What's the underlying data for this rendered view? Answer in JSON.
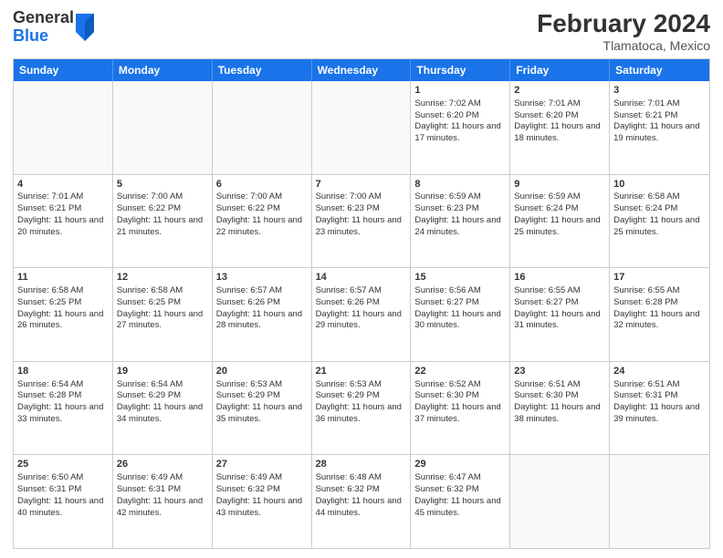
{
  "header": {
    "logo_general": "General",
    "logo_blue": "Blue",
    "month_title": "February 2024",
    "location": "Tlamatoca, Mexico"
  },
  "calendar": {
    "days_of_week": [
      "Sunday",
      "Monday",
      "Tuesday",
      "Wednesday",
      "Thursday",
      "Friday",
      "Saturday"
    ],
    "rows": [
      [
        {
          "day": "",
          "info": "",
          "empty": true
        },
        {
          "day": "",
          "info": "",
          "empty": true
        },
        {
          "day": "",
          "info": "",
          "empty": true
        },
        {
          "day": "",
          "info": "",
          "empty": true
        },
        {
          "day": "1",
          "info": "Sunrise: 7:02 AM\nSunset: 6:20 PM\nDaylight: 11 hours and 17 minutes.",
          "empty": false
        },
        {
          "day": "2",
          "info": "Sunrise: 7:01 AM\nSunset: 6:20 PM\nDaylight: 11 hours and 18 minutes.",
          "empty": false
        },
        {
          "day": "3",
          "info": "Sunrise: 7:01 AM\nSunset: 6:21 PM\nDaylight: 11 hours and 19 minutes.",
          "empty": false
        }
      ],
      [
        {
          "day": "4",
          "info": "Sunrise: 7:01 AM\nSunset: 6:21 PM\nDaylight: 11 hours and 20 minutes.",
          "empty": false
        },
        {
          "day": "5",
          "info": "Sunrise: 7:00 AM\nSunset: 6:22 PM\nDaylight: 11 hours and 21 minutes.",
          "empty": false
        },
        {
          "day": "6",
          "info": "Sunrise: 7:00 AM\nSunset: 6:22 PM\nDaylight: 11 hours and 22 minutes.",
          "empty": false
        },
        {
          "day": "7",
          "info": "Sunrise: 7:00 AM\nSunset: 6:23 PM\nDaylight: 11 hours and 23 minutes.",
          "empty": false
        },
        {
          "day": "8",
          "info": "Sunrise: 6:59 AM\nSunset: 6:23 PM\nDaylight: 11 hours and 24 minutes.",
          "empty": false
        },
        {
          "day": "9",
          "info": "Sunrise: 6:59 AM\nSunset: 6:24 PM\nDaylight: 11 hours and 25 minutes.",
          "empty": false
        },
        {
          "day": "10",
          "info": "Sunrise: 6:58 AM\nSunset: 6:24 PM\nDaylight: 11 hours and 25 minutes.",
          "empty": false
        }
      ],
      [
        {
          "day": "11",
          "info": "Sunrise: 6:58 AM\nSunset: 6:25 PM\nDaylight: 11 hours and 26 minutes.",
          "empty": false
        },
        {
          "day": "12",
          "info": "Sunrise: 6:58 AM\nSunset: 6:25 PM\nDaylight: 11 hours and 27 minutes.",
          "empty": false
        },
        {
          "day": "13",
          "info": "Sunrise: 6:57 AM\nSunset: 6:26 PM\nDaylight: 11 hours and 28 minutes.",
          "empty": false
        },
        {
          "day": "14",
          "info": "Sunrise: 6:57 AM\nSunset: 6:26 PM\nDaylight: 11 hours and 29 minutes.",
          "empty": false
        },
        {
          "day": "15",
          "info": "Sunrise: 6:56 AM\nSunset: 6:27 PM\nDaylight: 11 hours and 30 minutes.",
          "empty": false
        },
        {
          "day": "16",
          "info": "Sunrise: 6:55 AM\nSunset: 6:27 PM\nDaylight: 11 hours and 31 minutes.",
          "empty": false
        },
        {
          "day": "17",
          "info": "Sunrise: 6:55 AM\nSunset: 6:28 PM\nDaylight: 11 hours and 32 minutes.",
          "empty": false
        }
      ],
      [
        {
          "day": "18",
          "info": "Sunrise: 6:54 AM\nSunset: 6:28 PM\nDaylight: 11 hours and 33 minutes.",
          "empty": false
        },
        {
          "day": "19",
          "info": "Sunrise: 6:54 AM\nSunset: 6:29 PM\nDaylight: 11 hours and 34 minutes.",
          "empty": false
        },
        {
          "day": "20",
          "info": "Sunrise: 6:53 AM\nSunset: 6:29 PM\nDaylight: 11 hours and 35 minutes.",
          "empty": false
        },
        {
          "day": "21",
          "info": "Sunrise: 6:53 AM\nSunset: 6:29 PM\nDaylight: 11 hours and 36 minutes.",
          "empty": false
        },
        {
          "day": "22",
          "info": "Sunrise: 6:52 AM\nSunset: 6:30 PM\nDaylight: 11 hours and 37 minutes.",
          "empty": false
        },
        {
          "day": "23",
          "info": "Sunrise: 6:51 AM\nSunset: 6:30 PM\nDaylight: 11 hours and 38 minutes.",
          "empty": false
        },
        {
          "day": "24",
          "info": "Sunrise: 6:51 AM\nSunset: 6:31 PM\nDaylight: 11 hours and 39 minutes.",
          "empty": false
        }
      ],
      [
        {
          "day": "25",
          "info": "Sunrise: 6:50 AM\nSunset: 6:31 PM\nDaylight: 11 hours and 40 minutes.",
          "empty": false
        },
        {
          "day": "26",
          "info": "Sunrise: 6:49 AM\nSunset: 6:31 PM\nDaylight: 11 hours and 42 minutes.",
          "empty": false
        },
        {
          "day": "27",
          "info": "Sunrise: 6:49 AM\nSunset: 6:32 PM\nDaylight: 11 hours and 43 minutes.",
          "empty": false
        },
        {
          "day": "28",
          "info": "Sunrise: 6:48 AM\nSunset: 6:32 PM\nDaylight: 11 hours and 44 minutes.",
          "empty": false
        },
        {
          "day": "29",
          "info": "Sunrise: 6:47 AM\nSunset: 6:32 PM\nDaylight: 11 hours and 45 minutes.",
          "empty": false
        },
        {
          "day": "",
          "info": "",
          "empty": true
        },
        {
          "day": "",
          "info": "",
          "empty": true
        }
      ]
    ]
  }
}
